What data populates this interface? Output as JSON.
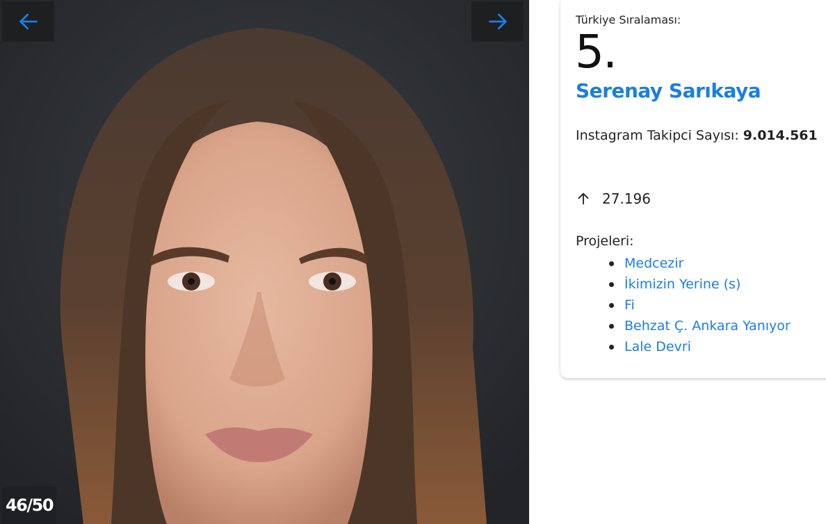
{
  "gallery": {
    "counter": "46/50",
    "prev_icon": "arrow-left-icon",
    "next_icon": "arrow-right-icon",
    "accent": "#1a7ee3"
  },
  "card": {
    "rank_label": "Türkiye Sıralaması:",
    "rank": "5.",
    "name": "Serenay Sarıkaya",
    "followers_label": "Instagram Takipci Sayısı:",
    "followers_value": "9.014.561",
    "change_icon": "arrow-up-icon",
    "change_value": "27.196",
    "projects_label": "Projeleri:",
    "projects": [
      {
        "title": "Medcezir"
      },
      {
        "title": "İkimizin Yerine (s)"
      },
      {
        "title": "Fi"
      },
      {
        "title": "Behzat Ç. Ankara Yanıyor"
      },
      {
        "title": "Lale Devri"
      }
    ]
  },
  "colors": {
    "link": "#1a7ee3",
    "text": "#222222",
    "nav_bg": "#1c1e21"
  }
}
